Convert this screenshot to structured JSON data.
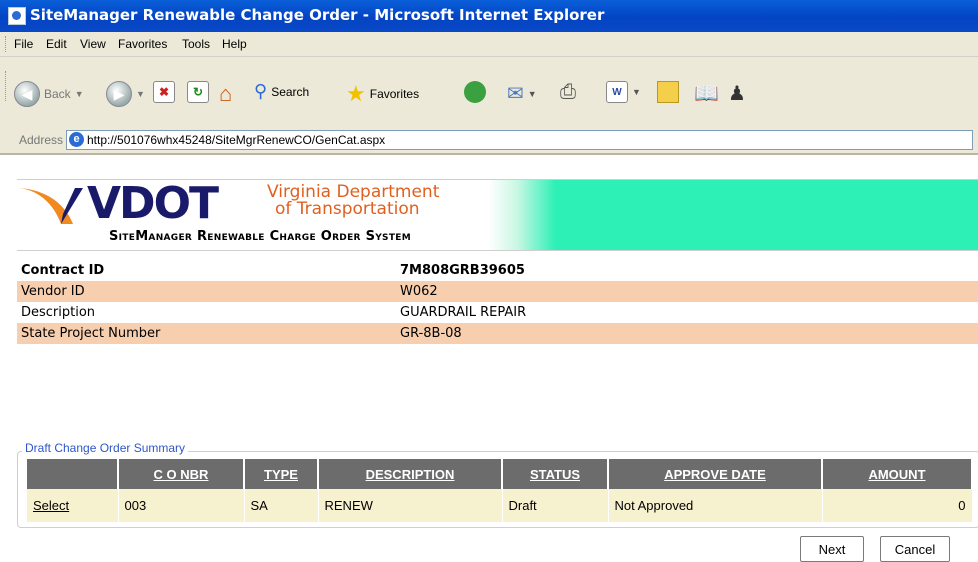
{
  "window": {
    "title": "SiteManager Renewable Change Order - Microsoft Internet Explorer"
  },
  "menu": {
    "items": [
      "File",
      "Edit",
      "View",
      "Favorites",
      "Tools",
      "Help"
    ]
  },
  "toolbar": {
    "back_label": "Back",
    "search_label": "Search",
    "favorites_label": "Favorites"
  },
  "address": {
    "label": "Address",
    "url": "http://501076whx45248/SiteMgrRenewCO/GenCat.aspx"
  },
  "banner": {
    "logo_text": "VDOT",
    "agency_line1": "Virginia Department",
    "agency_line2": "of Transportation",
    "system_name": "SiteManager Renewable Charge Order System"
  },
  "contract": {
    "rows": [
      {
        "label": "Contract ID",
        "value": "7M808GRB39605"
      },
      {
        "label": "Vendor ID",
        "value": "W062"
      },
      {
        "label": "Description",
        "value": "GUARDRAIL REPAIR"
      },
      {
        "label": "State Project Number",
        "value": "GR-8B-08"
      }
    ]
  },
  "summary": {
    "legend": "Draft Change Order Summary",
    "headers": [
      "",
      "C O NBR",
      "TYPE",
      "DESCRIPTION",
      "STATUS",
      "APPROVE DATE",
      "AMOUNT"
    ],
    "row": {
      "select": "Select",
      "co_nbr": "003",
      "type": "SA",
      "description": "RENEW",
      "status": "Draft",
      "approve_date": "Not Approved",
      "amount": "0"
    }
  },
  "buttons": {
    "next": "Next",
    "cancel": "Cancel"
  },
  "colors": {
    "titlebar": "#0a55d2",
    "chrome": "#ece9d8",
    "banner_accent": "#2cf0b6",
    "row_alt": "#f7cfae",
    "table_header": "#6c6c6c",
    "table_row": "#f6f1cf",
    "legend_text": "#2f56c9"
  }
}
